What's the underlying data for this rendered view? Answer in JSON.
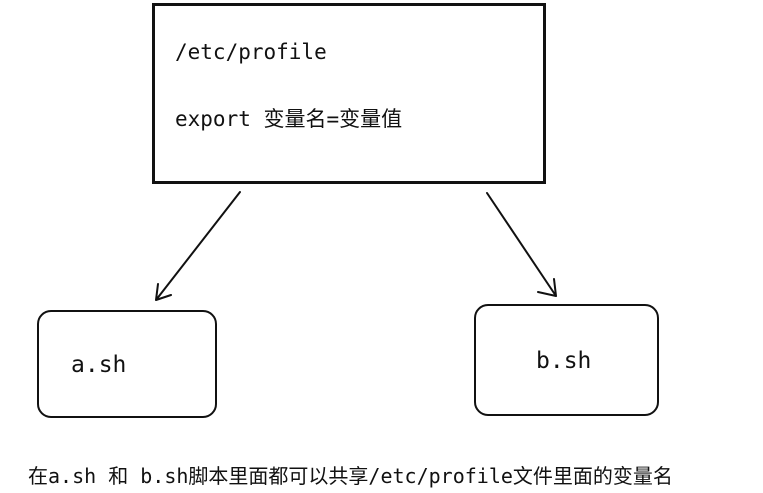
{
  "top_box": {
    "path": "/etc/profile",
    "export_line": "export 变量名=变量值"
  },
  "left_box": {
    "label": "a.sh"
  },
  "right_box": {
    "label": "b.sh"
  },
  "caption": "在a.sh 和 b.sh脚本里面都可以共享/etc/profile文件里面的变量名"
}
